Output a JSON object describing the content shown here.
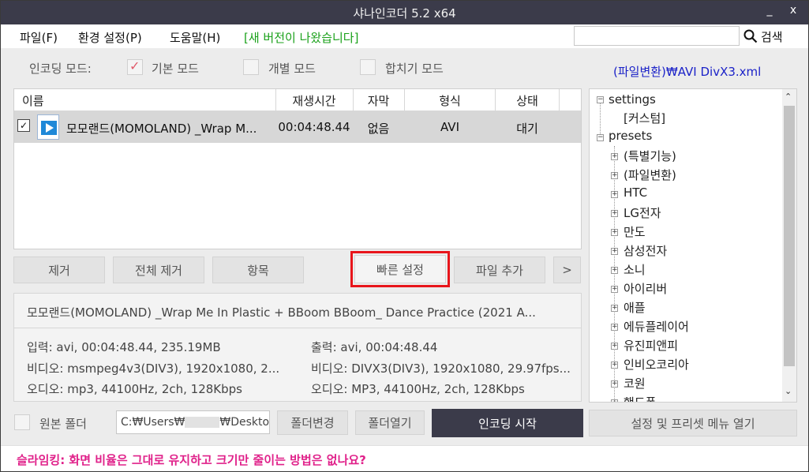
{
  "window": {
    "title": "샤나인코더  5.2 x64",
    "min": "_",
    "close": "x"
  },
  "menu": {
    "items": [
      "파일(F)",
      "환경 설정(P)",
      "도움말(H)"
    ],
    "notice": "[새 버전이 나왔습니다]",
    "notice_color": "#1aa11a"
  },
  "search": {
    "value": "",
    "button": "검색"
  },
  "mode": {
    "label": "인코딩 모드:",
    "options": [
      {
        "label": "기본 모드",
        "checked": true
      },
      {
        "label": "개별 모드",
        "checked": false
      },
      {
        "label": "합치기 모드",
        "checked": false
      }
    ],
    "preset_path": "(파일변환)₩AVI DivX3.xml"
  },
  "files": {
    "columns": [
      "이름",
      "재생시간",
      "자막",
      "형식",
      "상태"
    ],
    "rows": [
      {
        "checked": true,
        "name": "모모랜드(MOMOLAND) _Wrap M...",
        "duration": "00:04:48.44",
        "subtitle": "없음",
        "format": "AVI",
        "status": "대기"
      }
    ]
  },
  "actions": {
    "remove": "제거",
    "remove_all": "전체 제거",
    "item": "항목",
    "quick": "빠른 설정",
    "add": "파일 추가",
    "more": ">"
  },
  "info": {
    "title": "모모랜드(MOMOLAND) _Wrap Me In Plastic + BBoom BBoom_ Dance Practice (2021 A...",
    "input": "입력: avi, 00:04:48.44, 235.19MB",
    "output": "출력: avi, 00:04:48.44",
    "video_in": "비디오: msmpeg4v3(DIV3), 1920x1080, 2...",
    "video_out": "비디오: DIVX3(DIV3), 1920x1080, 29.97fps...",
    "audio_in": "오디오: mp3, 44100Hz, 2ch, 128Kbps",
    "audio_out": "오디오: MP3, 44100Hz, 2ch, 128Kbps"
  },
  "tree": {
    "settings": "settings",
    "custom": "[커스텀]",
    "presets": "presets",
    "items": [
      "(특별기능)",
      "(파일변환)",
      "HTC",
      "LG전자",
      "만도",
      "삼성전자",
      "소니",
      "아이리버",
      "애플",
      "에듀플레이어",
      "유진피앤피",
      "인비오코리아",
      "코원",
      "핸드폰"
    ]
  },
  "bottom": {
    "source_folder": "원본 폴더",
    "path_prefix": "C:₩Users₩",
    "path_suffix": "₩Desktop",
    "change": "폴더변경",
    "open": "폴더열기",
    "encode": "인코딩 시작",
    "settings": "설정 및 프리셋 메뉴 열기"
  },
  "status": "슬라임킹: 화면 비율은 그대로 유지하고 크기만 줄이는 방법은 없나요?"
}
